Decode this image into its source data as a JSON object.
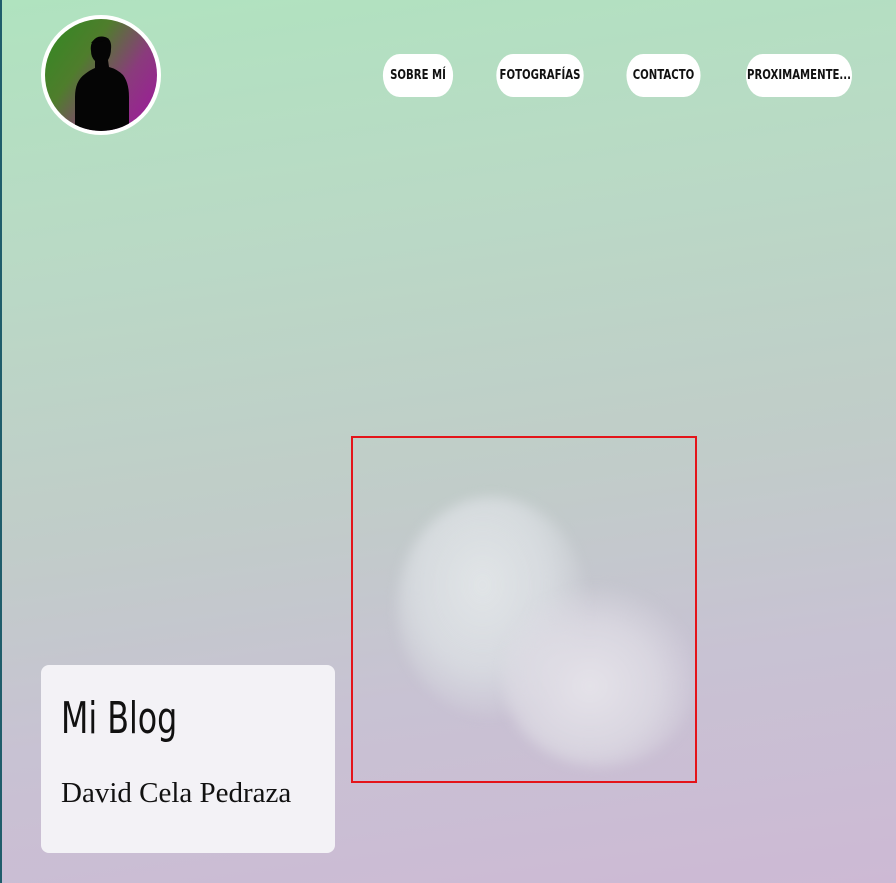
{
  "header": {
    "avatar_icon": "person-silhouette-icon",
    "nav": [
      {
        "label": "SOBRE MÍ"
      },
      {
        "label": "FOTOGRAFÍAS"
      },
      {
        "label": "CONTACTO"
      },
      {
        "label": "PROXIMAMENTE..."
      }
    ]
  },
  "hero": {
    "title": "Mi Blog",
    "author": "David Cela Pedraza"
  },
  "colors": {
    "background_top": "#b0e3bf",
    "background_bottom": "#cdb9d4",
    "highlight_border": "#e4141a",
    "card_background": "#f3f2f6"
  }
}
